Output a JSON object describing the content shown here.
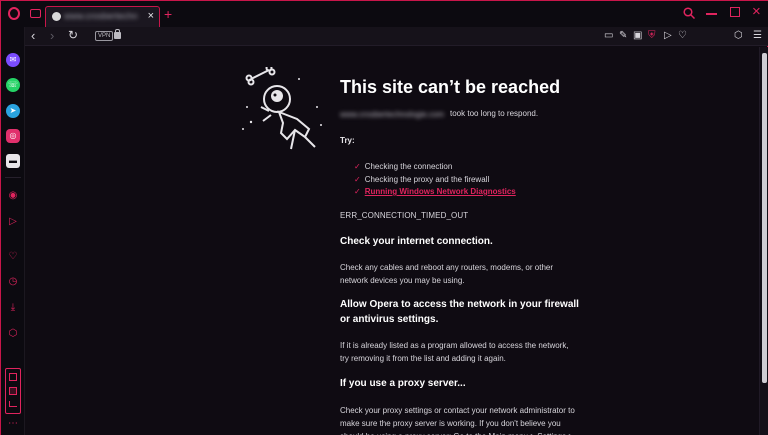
{
  "tab": {
    "title": "www.crosbertechnologie.com"
  },
  "address_bar": {
    "vpn_label": "VPN"
  },
  "page": {
    "title": "This site can’t be reached",
    "domain": "www.crosbertechnologie.com",
    "timeout_text": "took too long to respond.",
    "try_label": "Try:",
    "suggestions": [
      "Checking the connection",
      "Checking the proxy and the firewall",
      "Running Windows Network Diagnostics"
    ],
    "error_code": "ERR_CONNECTION_TIMED_OUT",
    "section1": {
      "heading": "Check your internet connection.",
      "body": "Check any cables and reboot any routers, modems, or other network devices you may be using."
    },
    "section2": {
      "heading": "Allow Opera to access the network in your firewall or antivirus settings.",
      "body": "If it is already listed as a program allowed to access the network, try removing it from the list and adding it again."
    },
    "section3": {
      "heading": "If you use a proxy server...",
      "body": "Check your proxy settings or contact your network administrator to make sure the proxy server is working. If you don't believe you should be using a proxy server: Go to the Main menu > Settings >"
    }
  },
  "colors": {
    "accent": "#e0245e",
    "background": "#0f0b12"
  },
  "icons": {
    "sidebar": [
      "messenger-icon",
      "whatsapp-icon",
      "telegram-icon",
      "instagram-icon",
      "chat-icon",
      "record-icon",
      "send-icon",
      "heart-icon",
      "history-icon",
      "download-icon",
      "cube-icon"
    ],
    "toolbar": [
      "reader-icon",
      "edit-icon",
      "camera-icon",
      "shield-icon",
      "play-icon",
      "heart-icon",
      "cube-icon",
      "settings-icon"
    ]
  }
}
